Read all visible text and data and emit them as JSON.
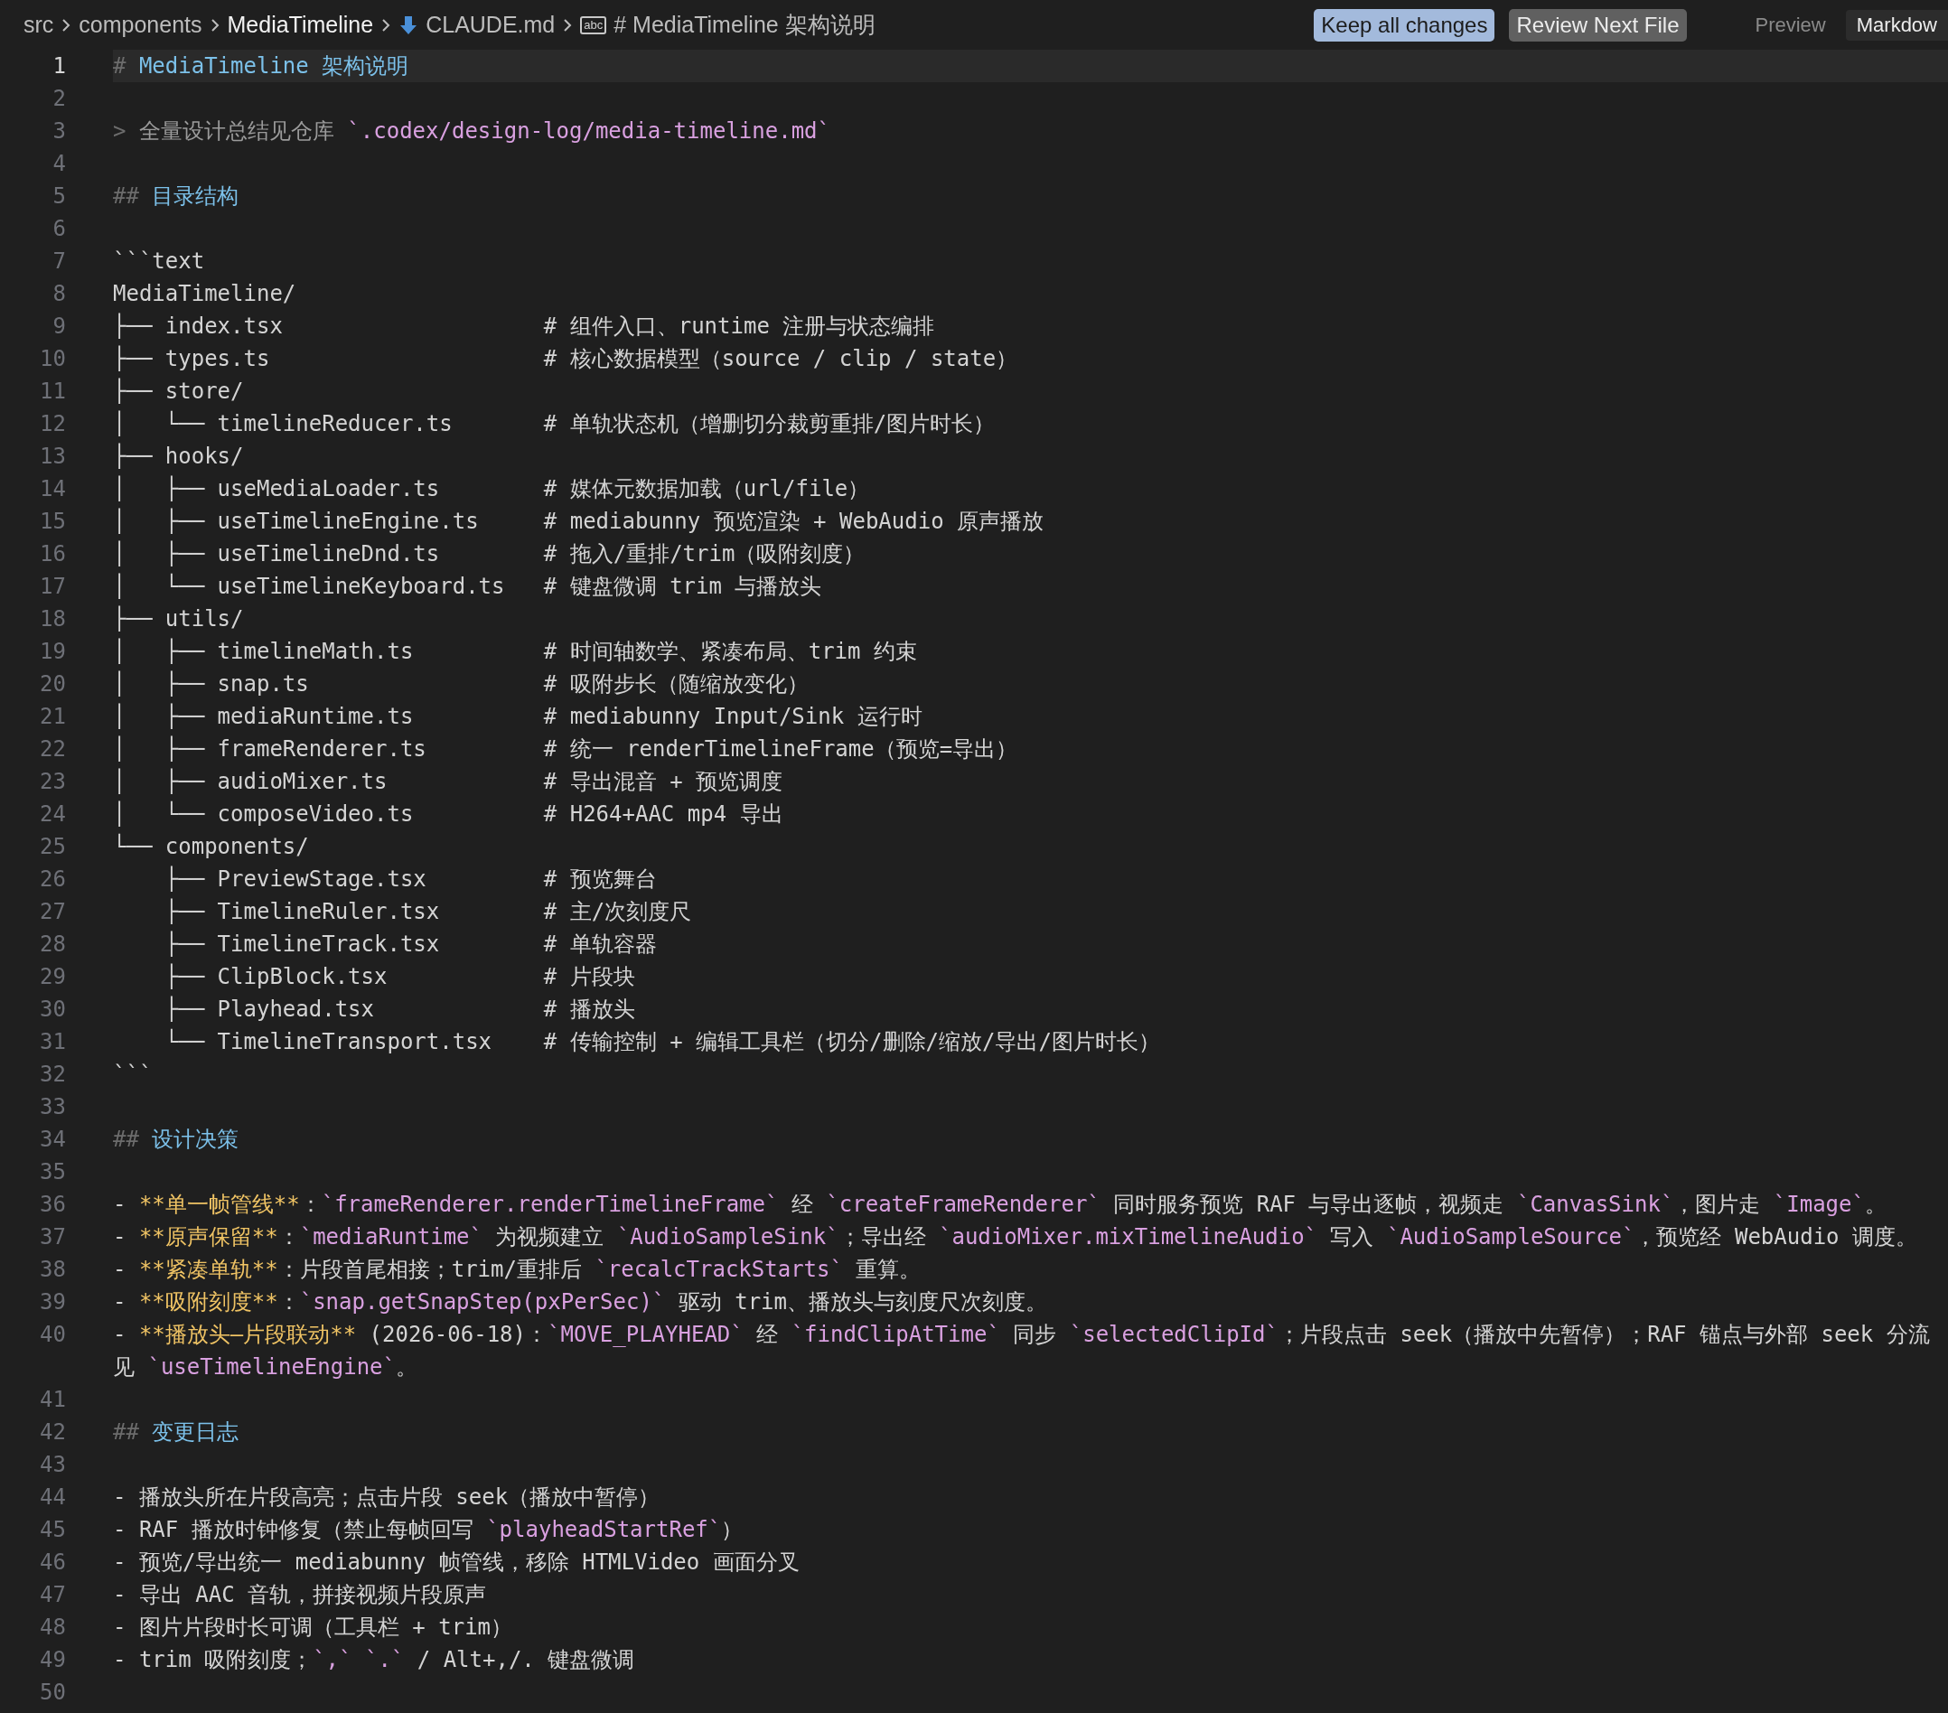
{
  "breadcrumbs": [
    {
      "label": "src",
      "kind": "folder",
      "selected": false
    },
    {
      "label": "components",
      "kind": "folder",
      "selected": false
    },
    {
      "label": "MediaTimeline",
      "kind": "folder",
      "selected": true
    },
    {
      "label": "CLAUDE.md",
      "kind": "file",
      "selected": false
    },
    {
      "label": "# MediaTimeline 架构说明",
      "kind": "symbol",
      "icon_text": "abc",
      "selected": false
    }
  ],
  "actions": [
    {
      "label": "Keep all changes",
      "kind": "primary"
    },
    {
      "label": "Review Next File",
      "kind": "secondary"
    }
  ],
  "view_tabs": [
    {
      "label": "Preview",
      "selected": false
    },
    {
      "label": "Markdow",
      "selected": true
    }
  ],
  "lines": [
    {
      "number": "1",
      "selected": true,
      "segments": [
        {
          "kind": "mark",
          "text": "# "
        },
        {
          "kind": "heading",
          "text": "MediaTimeline 架构说明"
        }
      ]
    },
    {
      "number": "2",
      "selected": false
    },
    {
      "number": "3",
      "selected": false,
      "segments": [
        {
          "kind": "mark",
          "text": "> "
        },
        {
          "kind": "quote",
          "text": "全量设计总结见仓库 "
        },
        {
          "kind": "code",
          "text": "`.codex/design-log/media-timeline.md`"
        }
      ]
    },
    {
      "number": "4",
      "selected": false
    },
    {
      "number": "5",
      "selected": false,
      "segments": [
        {
          "kind": "mark",
          "text": "## "
        },
        {
          "kind": "heading",
          "text": "目录结构"
        }
      ]
    },
    {
      "number": "6",
      "selected": false
    },
    {
      "number": "7",
      "selected": false,
      "segments": [
        {
          "kind": "text",
          "text": "```text"
        }
      ]
    },
    {
      "number": "8",
      "selected": false,
      "segments": [
        {
          "kind": "text",
          "text": "MediaTimeline/"
        }
      ]
    },
    {
      "number": "9",
      "selected": false,
      "segments": [
        {
          "kind": "text",
          "text": "├── index.tsx                    # 组件入口、runtime 注册与状态编排"
        }
      ]
    },
    {
      "number": "10",
      "selected": false,
      "segments": [
        {
          "kind": "text",
          "text": "├── types.ts                     # 核心数据模型（source / clip / state）"
        }
      ]
    },
    {
      "number": "11",
      "selected": false,
      "segments": [
        {
          "kind": "text",
          "text": "├── store/"
        }
      ]
    },
    {
      "number": "12",
      "selected": false,
      "segments": [
        {
          "kind": "text",
          "text": "│   └── timelineReducer.ts       # 单轨状态机（增删切分裁剪重排/图片时长）"
        }
      ]
    },
    {
      "number": "13",
      "selected": false,
      "segments": [
        {
          "kind": "text",
          "text": "├── hooks/"
        }
      ]
    },
    {
      "number": "14",
      "selected": false,
      "segments": [
        {
          "kind": "text",
          "text": "│   ├── useMediaLoader.ts        # 媒体元数据加载（url/file）"
        }
      ]
    },
    {
      "number": "15",
      "selected": false,
      "segments": [
        {
          "kind": "text",
          "text": "│   ├── useTimelineEngine.ts     # mediabunny 预览渲染 + WebAudio 原声播放"
        }
      ]
    },
    {
      "number": "16",
      "selected": false,
      "segments": [
        {
          "kind": "text",
          "text": "│   ├── useTimelineDnd.ts        # 拖入/重排/trim（吸附刻度）"
        }
      ]
    },
    {
      "number": "17",
      "selected": false,
      "segments": [
        {
          "kind": "text",
          "text": "│   └── useTimelineKeyboard.ts   # 键盘微调 trim 与播放头"
        }
      ]
    },
    {
      "number": "18",
      "selected": false,
      "segments": [
        {
          "kind": "text",
          "text": "├── utils/"
        }
      ]
    },
    {
      "number": "19",
      "selected": false,
      "segments": [
        {
          "kind": "text",
          "text": "│   ├── timelineMath.ts          # 时间轴数学、紧凑布局、trim 约束"
        }
      ]
    },
    {
      "number": "20",
      "selected": false,
      "segments": [
        {
          "kind": "text",
          "text": "│   ├── snap.ts                  # 吸附步长（随缩放变化）"
        }
      ]
    },
    {
      "number": "21",
      "selected": false,
      "segments": [
        {
          "kind": "text",
          "text": "│   ├── mediaRuntime.ts          # mediabunny Input/Sink 运行时"
        }
      ]
    },
    {
      "number": "22",
      "selected": false,
      "segments": [
        {
          "kind": "text",
          "text": "│   ├── frameRenderer.ts         # 统一 renderTimelineFrame（预览=导出）"
        }
      ]
    },
    {
      "number": "23",
      "selected": false,
      "segments": [
        {
          "kind": "text",
          "text": "│   ├── audioMixer.ts            # 导出混音 + 预览调度"
        }
      ]
    },
    {
      "number": "24",
      "selected": false,
      "segments": [
        {
          "kind": "text",
          "text": "│   └── composeVideo.ts          # H264+AAC mp4 导出"
        }
      ]
    },
    {
      "number": "25",
      "selected": false,
      "segments": [
        {
          "kind": "text",
          "text": "└── components/"
        }
      ]
    },
    {
      "number": "26",
      "selected": false,
      "segments": [
        {
          "kind": "text",
          "text": "    ├── PreviewStage.tsx         # 预览舞台"
        }
      ]
    },
    {
      "number": "27",
      "selected": false,
      "segments": [
        {
          "kind": "text",
          "text": "    ├── TimelineRuler.tsx        # 主/次刻度尺"
        }
      ]
    },
    {
      "number": "28",
      "selected": false,
      "segments": [
        {
          "kind": "text",
          "text": "    ├── TimelineTrack.tsx        # 单轨容器"
        }
      ]
    },
    {
      "number": "29",
      "selected": false,
      "segments": [
        {
          "kind": "text",
          "text": "    ├── ClipBlock.tsx            # 片段块"
        }
      ]
    },
    {
      "number": "30",
      "selected": false,
      "segments": [
        {
          "kind": "text",
          "text": "    ├── Playhead.tsx             # 播放头"
        }
      ]
    },
    {
      "number": "31",
      "selected": false,
      "segments": [
        {
          "kind": "text",
          "text": "    └── TimelineTransport.tsx    # 传输控制 + 编辑工具栏（切分/删除/缩放/导出/图片时长）"
        }
      ]
    },
    {
      "number": "32",
      "selected": false,
      "segments": [
        {
          "kind": "text",
          "text": "```"
        }
      ]
    },
    {
      "number": "33",
      "selected": false
    },
    {
      "number": "34",
      "selected": false,
      "segments": [
        {
          "kind": "mark",
          "text": "## "
        },
        {
          "kind": "heading",
          "text": "设计决策"
        }
      ]
    },
    {
      "number": "35",
      "selected": false
    },
    {
      "number": "36",
      "selected": false,
      "segments": [
        {
          "kind": "text",
          "text": "- "
        },
        {
          "kind": "bold",
          "text": "**单一帧管线**"
        },
        {
          "kind": "text",
          "text": "："
        },
        {
          "kind": "code",
          "text": "`frameRenderer.renderTimelineFrame`"
        },
        {
          "kind": "text",
          "text": " 经 "
        },
        {
          "kind": "code",
          "text": "`createFrameRenderer`"
        },
        {
          "kind": "text",
          "text": " 同时服务预览 RAF 与导出逐帧，视频走 "
        },
        {
          "kind": "code",
          "text": "`CanvasSink`"
        },
        {
          "kind": "text",
          "text": "，图片走 "
        },
        {
          "kind": "code",
          "text": "`Image`"
        },
        {
          "kind": "text",
          "text": "。"
        }
      ]
    },
    {
      "number": "37",
      "selected": false,
      "segments": [
        {
          "kind": "text",
          "text": "- "
        },
        {
          "kind": "bold",
          "text": "**原声保留**"
        },
        {
          "kind": "text",
          "text": "："
        },
        {
          "kind": "code",
          "text": "`mediaRuntime`"
        },
        {
          "kind": "text",
          "text": " 为视频建立 "
        },
        {
          "kind": "code",
          "text": "`AudioSampleSink`"
        },
        {
          "kind": "text",
          "text": "；导出经 "
        },
        {
          "kind": "code",
          "text": "`audioMixer.mixTimelineAudio`"
        },
        {
          "kind": "text",
          "text": " 写入 "
        },
        {
          "kind": "code",
          "text": "`AudioSampleSource`"
        },
        {
          "kind": "text",
          "text": "，预览经 WebAudio 调度。"
        }
      ]
    },
    {
      "number": "38",
      "selected": false,
      "segments": [
        {
          "kind": "text",
          "text": "- "
        },
        {
          "kind": "bold",
          "text": "**紧凑单轨**"
        },
        {
          "kind": "text",
          "text": "：片段首尾相接；trim/重排后 "
        },
        {
          "kind": "code",
          "text": "`recalcTrackStarts`"
        },
        {
          "kind": "text",
          "text": " 重算。"
        }
      ]
    },
    {
      "number": "39",
      "selected": false,
      "segments": [
        {
          "kind": "text",
          "text": "- "
        },
        {
          "kind": "bold",
          "text": "**吸附刻度**"
        },
        {
          "kind": "text",
          "text": "："
        },
        {
          "kind": "code",
          "text": "`snap.getSnapStep(pxPerSec)`"
        },
        {
          "kind": "text",
          "text": " 驱动 trim、播放头与刻度尺次刻度。"
        }
      ]
    },
    {
      "number": "40",
      "selected": false,
      "segments": [
        {
          "kind": "text",
          "text": "- "
        },
        {
          "kind": "bold",
          "text": "**播放头—片段联动**"
        },
        {
          "kind": "text",
          "text": " (2026-06-18)："
        },
        {
          "kind": "code",
          "text": "`MOVE_PLAYHEAD`"
        },
        {
          "kind": "text",
          "text": " 经 "
        },
        {
          "kind": "code",
          "text": "`findClipAtTime`"
        },
        {
          "kind": "text",
          "text": " 同步 "
        },
        {
          "kind": "code",
          "text": "`selectedClipId`"
        },
        {
          "kind": "text",
          "text": "；片段点击 seek（播放中先暂停）；RAF 锚点与外部 seek 分流"
        }
      ],
      "wrap": [
        {
          "kind": "text",
          "text": "见 "
        },
        {
          "kind": "code",
          "text": "`useTimelineEngine`"
        },
        {
          "kind": "text",
          "text": "。"
        }
      ]
    },
    {
      "number": "41",
      "selected": false
    },
    {
      "number": "42",
      "selected": false,
      "segments": [
        {
          "kind": "mark",
          "text": "## "
        },
        {
          "kind": "heading",
          "text": "变更日志"
        }
      ]
    },
    {
      "number": "43",
      "selected": false
    },
    {
      "number": "44",
      "selected": false,
      "segments": [
        {
          "kind": "text",
          "text": "- 播放头所在片段高亮；点击片段 seek（播放中暂停）"
        }
      ]
    },
    {
      "number": "45",
      "selected": false,
      "segments": [
        {
          "kind": "text",
          "text": "- RAF 播放时钟修复（禁止每帧回写 "
        },
        {
          "kind": "code",
          "text": "`playheadStartRef`"
        },
        {
          "kind": "text",
          "text": "）"
        }
      ]
    },
    {
      "number": "46",
      "selected": false,
      "segments": [
        {
          "kind": "text",
          "text": "- 预览/导出统一 mediabunny 帧管线，移除 HTMLVideo 画面分叉"
        }
      ]
    },
    {
      "number": "47",
      "selected": false,
      "segments": [
        {
          "kind": "text",
          "text": "- 导出 AAC 音轨，拼接视频片段原声"
        }
      ]
    },
    {
      "number": "48",
      "selected": false,
      "segments": [
        {
          "kind": "text",
          "text": "- 图片片段时长可调（工具栏 + trim）"
        }
      ]
    },
    {
      "number": "49",
      "selected": false,
      "segments": [
        {
          "kind": "text",
          "text": "- trim 吸附刻度；"
        },
        {
          "kind": "code",
          "text": "`,` `.`"
        },
        {
          "kind": "text",
          "text": " / Alt+,/. 键盘微调"
        }
      ]
    },
    {
      "number": "50",
      "selected": false
    }
  ]
}
